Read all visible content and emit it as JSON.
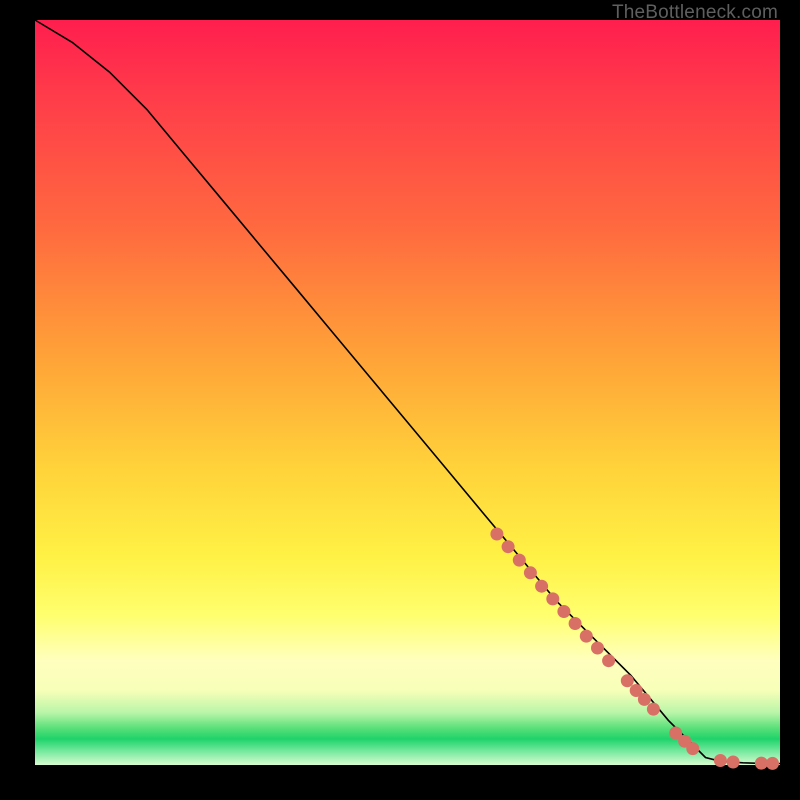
{
  "watermark": "TheBottleneck.com",
  "colors": {
    "dot": "#d97066",
    "curve": "#000000"
  },
  "chart_data": {
    "type": "line",
    "title": "",
    "xlabel": "",
    "ylabel": "",
    "xlim": [
      0,
      100
    ],
    "ylim": [
      0,
      100
    ],
    "grid": false,
    "note": "Bottleneck percentage curve. Y axis = bottleneck % (red high, green low). Curve starts at 100% top-left, descends roughly linearly to ~0% near x≈90, then flattens.",
    "series": [
      {
        "name": "bottleneck-curve",
        "x": [
          0,
          5,
          10,
          15,
          20,
          25,
          30,
          35,
          40,
          45,
          50,
          55,
          60,
          65,
          70,
          75,
          80,
          85,
          88,
          90,
          92,
          95,
          98,
          100
        ],
        "y": [
          100,
          97,
          93,
          88,
          82,
          76,
          70,
          64,
          58,
          52,
          46,
          40,
          34,
          28,
          22,
          17,
          12,
          6,
          3,
          1,
          0.5,
          0.3,
          0.2,
          0.2
        ]
      }
    ],
    "highlight_points": {
      "name": "sample-dots",
      "comment": "Salmon-colored sample points overlaid on the lower-right of the curve",
      "x": [
        62,
        63.5,
        65,
        66.5,
        68,
        69.5,
        71,
        72.5,
        74,
        75.5,
        77,
        79.5,
        80.7,
        81.8,
        83,
        86,
        87.2,
        88.3,
        92,
        93.7,
        97.5,
        99
      ],
      "y": [
        31,
        29.3,
        27.5,
        25.8,
        24,
        22.3,
        20.6,
        19,
        17.3,
        15.7,
        14,
        11.3,
        10,
        8.8,
        7.5,
        4.3,
        3.2,
        2.2,
        0.6,
        0.4,
        0.25,
        0.22
      ]
    }
  }
}
